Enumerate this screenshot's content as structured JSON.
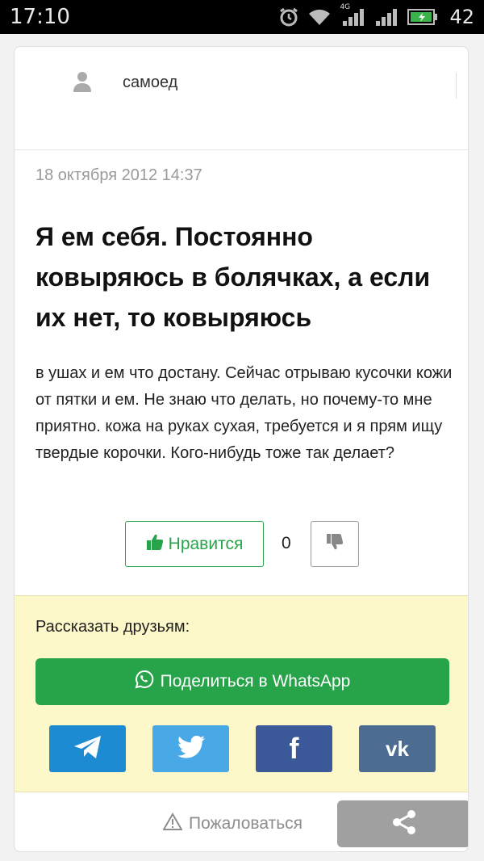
{
  "status_bar": {
    "time": "17:10",
    "network_label": "4G",
    "battery_percent": "42"
  },
  "post": {
    "author": "самоед",
    "date": "18 октября 2012 14:37",
    "title": "Я ем себя. Постоянно ковыряюсь в болячках, а если их нет, то ковыряюсь",
    "body": "в ушах и ем что достану. Сейчас отрываю кусочки кожи от пятки и ем. Не знаю что делать, но почему-то мне приятно. кожа на руках сухая, требуется и я прям ищу твердые корочки. Кого-нибудь тоже так делает?",
    "like_label": "Нравится",
    "vote_count": "0"
  },
  "share": {
    "title": "Рассказать друзьям:",
    "whatsapp_label": "Поделиться в WhatsApp",
    "networks": [
      "telegram-icon",
      "twitter-icon",
      "facebook-icon",
      "vk-icon"
    ],
    "vk_text": "vk",
    "facebook_text": "f"
  },
  "footer": {
    "report_label": "Пожаловаться"
  },
  "colors": {
    "accent_green": "#27a34a",
    "share_panel_bg": "#fdf8c9",
    "telegram": "#1d8bd1",
    "twitter": "#48a9e6",
    "facebook": "#3b5999",
    "vk": "#4c6c91"
  }
}
